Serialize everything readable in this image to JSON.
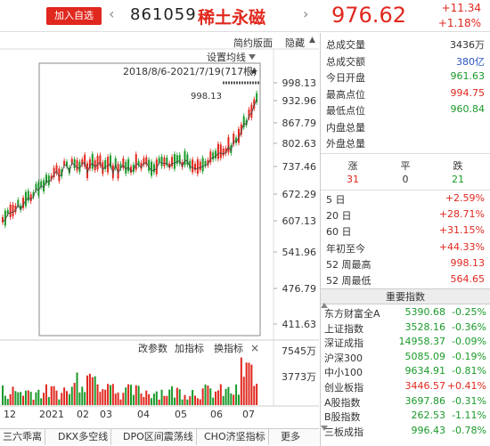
{
  "header": {
    "add_label": "加入自选",
    "code": "861059",
    "name": "稀土永磁",
    "price": "976.62",
    "change": "+11.34",
    "change_pct": "+1.18%"
  },
  "toolbar": {
    "simple": "简约版面",
    "hide": "隐藏",
    "ma_settings": "设置均线",
    "range": "2018/8/6-2021/7/19(717根)",
    "max_label": "998.13"
  },
  "price_axis": [
    "998.13",
    "932.96",
    "867.79",
    "802.63",
    "737.46",
    "672.29",
    "607.13",
    "541.96",
    "476.79",
    "411.63"
  ],
  "volume_tools": {
    "params": "改参数",
    "add_indicator": "加指标",
    "switch_indicator": "换指标"
  },
  "volume_axis": [
    "7545万",
    "3773万"
  ],
  "date_axis": [
    "12",
    "2021",
    "02",
    "03",
    "04",
    "05",
    "06",
    "07"
  ],
  "bottom_tabs": [
    "三六乖离",
    "DKX多空线",
    "DPO区间震荡线",
    "CHO济坚指标",
    "更多"
  ],
  "stats": [
    {
      "k": "总成交量",
      "v": "3436万",
      "c": "dark"
    },
    {
      "k": "总成交额",
      "v": "380亿",
      "c": "blue"
    },
    {
      "k": "今日开盘",
      "v": "961.63",
      "c": "green"
    },
    {
      "k": "最高点位",
      "v": "994.75",
      "c": "red"
    },
    {
      "k": "最低点位",
      "v": "960.84",
      "c": "green"
    },
    {
      "k": "内盘总量",
      "v": "",
      "c": "dark"
    },
    {
      "k": "外盘总量",
      "v": "",
      "c": "dark"
    }
  ],
  "breadth": {
    "up_label": "涨",
    "flat_label": "平",
    "down_label": "跌",
    "up": "31",
    "flat": "0",
    "down": "21"
  },
  "periods": [
    {
      "k": "5 日",
      "v": "+2.59%"
    },
    {
      "k": "20 日",
      "v": "+28.71%"
    },
    {
      "k": "60 日",
      "v": "+31.15%"
    },
    {
      "k": "年初至今",
      "v": "+44.33%"
    },
    {
      "k": "52 周最高",
      "v": "998.13"
    },
    {
      "k": "52 周最低",
      "v": "564.65"
    }
  ],
  "index_header": "重要指数",
  "indices": [
    {
      "n": "东方财富全A",
      "v": "5390.68",
      "p": "-0.25%",
      "vc": "green",
      "pc": "green"
    },
    {
      "n": "上证指数",
      "v": "3528.16",
      "p": "-0.36%",
      "vc": "green",
      "pc": "green"
    },
    {
      "n": "深证成指",
      "v": "14958.37",
      "p": "-0.09%",
      "vc": "green",
      "pc": "green"
    },
    {
      "n": "沪深300",
      "v": "5085.09",
      "p": "-0.19%",
      "vc": "green",
      "pc": "green"
    },
    {
      "n": "中小100",
      "v": "9634.91",
      "p": "-0.81%",
      "vc": "green",
      "pc": "green"
    },
    {
      "n": "创业板指",
      "v": "3446.57",
      "p": "+0.41%",
      "vc": "red",
      "pc": "red"
    },
    {
      "n": "A股指数",
      "v": "3697.86",
      "p": "-0.31%",
      "vc": "green",
      "pc": "green"
    },
    {
      "n": "B股指数",
      "v": "262.53",
      "p": "-1.11%",
      "vc": "green",
      "pc": "green"
    },
    {
      "n": "三板成指",
      "v": "996.43",
      "p": "-0.78%",
      "vc": "green",
      "pc": "green"
    }
  ],
  "colors": {
    "up": "#e0281e",
    "down": "#1a9a2a",
    "accent_blue": "#2a55c8"
  }
}
